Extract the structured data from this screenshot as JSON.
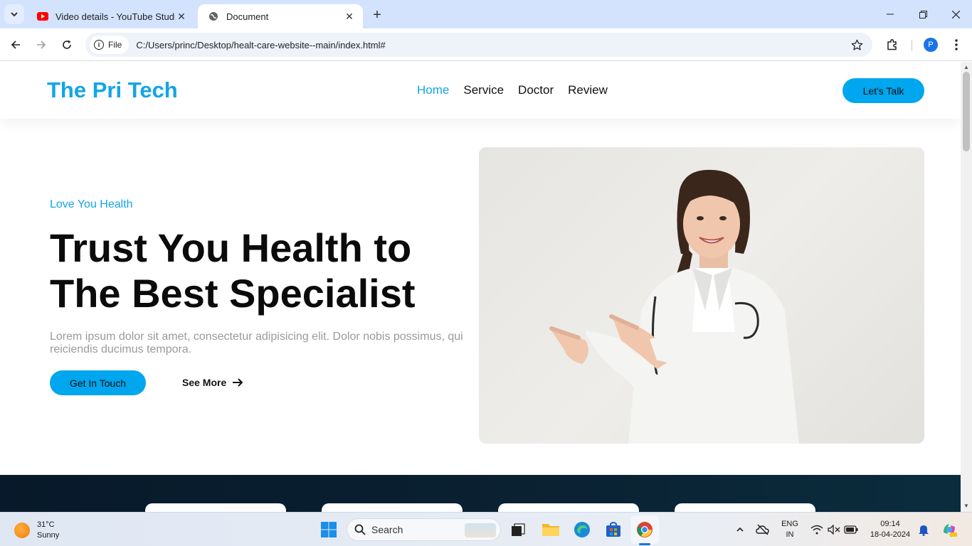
{
  "browser": {
    "tabs": [
      {
        "title": "Video details - YouTube Studio",
        "active": false,
        "icon": "youtube-icon"
      },
      {
        "title": "Document",
        "active": true,
        "icon": "globe-icon"
      }
    ],
    "omnibox": {
      "chip": "File",
      "url": "C:/Users/princ/Desktop/healt-care-website--main/index.html#"
    },
    "profile_initial": "P"
  },
  "site": {
    "logo": "The Pri Tech",
    "nav": [
      {
        "label": "Home",
        "active": true
      },
      {
        "label": "Service",
        "active": false
      },
      {
        "label": "Doctor",
        "active": false
      },
      {
        "label": "Review",
        "active": false
      }
    ],
    "cta": "Let's Talk",
    "hero": {
      "eyebrow": "Love You Health",
      "title": "Trust You Health to The Best Specialist",
      "text": "Lorem ipsum dolor sit amet, consectetur adipisicing elit. Dolor nobis possimus, qui reiciendis ducimus tempora.",
      "primary_button": "Get In Touch",
      "secondary_link": "See More",
      "image_icon": "doctor-photo"
    },
    "colors": {
      "accent": "#12a5e6",
      "button": "#00a6ee",
      "dark_band": "#07192a"
    }
  },
  "taskbar": {
    "weather": {
      "temp": "31°C",
      "condition": "Sunny"
    },
    "search_placeholder": "Search",
    "language": {
      "line1": "ENG",
      "line2": "IN"
    },
    "clock": {
      "time": "09:14",
      "date": "18-04-2024"
    }
  }
}
